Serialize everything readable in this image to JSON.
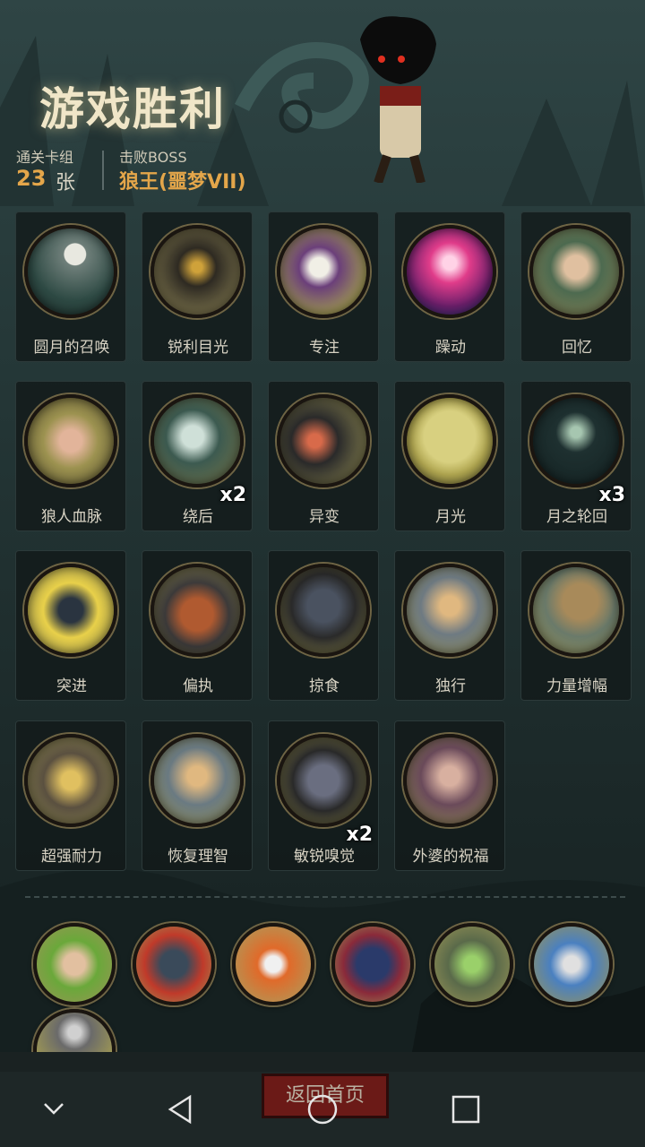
{
  "result": {
    "title": "游戏胜利",
    "deck_label": "通关卡组",
    "deck_count": "23",
    "deck_unit": "张",
    "boss_label": "击败BOSS",
    "boss_name": "狼王(噩梦VII)"
  },
  "cards": [
    {
      "label": "圆月的召唤",
      "count": "",
      "icon": "full-moon-forest"
    },
    {
      "label": "锐利目光",
      "count": "",
      "icon": "glaring-wolf"
    },
    {
      "label": "专注",
      "count": "",
      "icon": "wizard"
    },
    {
      "label": "躁动",
      "count": "",
      "icon": "pink-frenzy"
    },
    {
      "label": "回忆",
      "count": "",
      "icon": "old-man"
    },
    {
      "label": "狼人血脉",
      "count": "",
      "icon": "clawed-arm"
    },
    {
      "label": "绕后",
      "count": "x2",
      "icon": "skull-ambush"
    },
    {
      "label": "异变",
      "count": "",
      "icon": "mutation"
    },
    {
      "label": "月光",
      "count": "",
      "icon": "wolf-moon"
    },
    {
      "label": "月之轮回",
      "count": "x3",
      "icon": "moon-phases"
    },
    {
      "label": "突进",
      "count": "",
      "icon": "wolf-charge"
    },
    {
      "label": "偏执",
      "count": "",
      "icon": "roaring-bear"
    },
    {
      "label": "掠食",
      "count": "",
      "icon": "prey"
    },
    {
      "label": "独行",
      "count": "",
      "icon": "lone-walker"
    },
    {
      "label": "力量增幅",
      "count": "",
      "icon": "log-carry"
    },
    {
      "label": "超强耐力",
      "count": "",
      "icon": "endurance"
    },
    {
      "label": "恢复理智",
      "count": "",
      "icon": "sanity"
    },
    {
      "label": "敏锐嗅觉",
      "count": "x2",
      "icon": "sniffing-wolf"
    },
    {
      "label": "外婆的祝福",
      "count": "",
      "icon": "grandma"
    }
  ],
  "relics": [
    {
      "icon": "poison-body"
    },
    {
      "icon": "red-wolf"
    },
    {
      "icon": "fire-drop"
    },
    {
      "icon": "red-book"
    },
    {
      "icon": "zombie"
    },
    {
      "icon": "lightning-compass"
    },
    {
      "icon": "crossed-blades"
    }
  ],
  "buttons": {
    "return_home": "返回首页"
  },
  "colors": {
    "accent": "#e4a64a",
    "button": "#6b1a17",
    "card_ring": "#6e6444"
  }
}
